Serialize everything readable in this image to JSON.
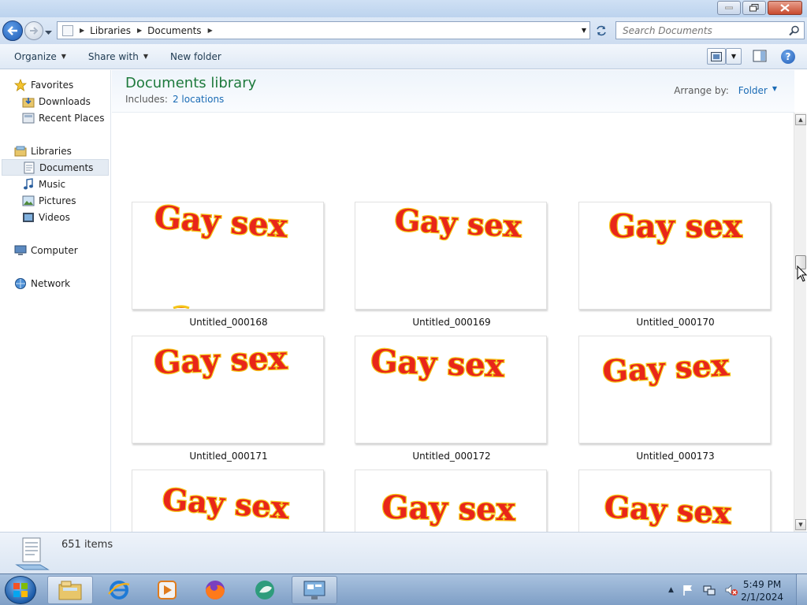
{
  "window": {
    "minimize_icon": "minimize-icon",
    "maximize_icon": "restore-icon",
    "close_icon": "close-icon"
  },
  "address_bar": {
    "crumbs": [
      "Libraries",
      "Documents"
    ],
    "search_placeholder": "Search Documents"
  },
  "toolbar": {
    "organize": "Organize",
    "share_with": "Share with",
    "new_folder": "New folder"
  },
  "nav": {
    "favorites": "Favorites",
    "downloads": "Downloads",
    "recent_places": "Recent Places",
    "libraries": "Libraries",
    "documents": "Documents",
    "music": "Music",
    "pictures": "Pictures",
    "videos": "Videos",
    "computer": "Computer",
    "network": "Network"
  },
  "library": {
    "title": "Documents library",
    "includes_label": "Includes:",
    "includes_link": "2 locations",
    "arrange_label": "Arrange by:",
    "arrange_value": "Folder"
  },
  "files": [
    {
      "name": "Untitled_000168",
      "thumb_text": "Gay sex"
    },
    {
      "name": "Untitled_000169",
      "thumb_text": "Gay sex"
    },
    {
      "name": "Untitled_000170",
      "thumb_text": "Gay sex"
    },
    {
      "name": "Untitled_000171",
      "thumb_text": "Gay sex"
    },
    {
      "name": "Untitled_000172",
      "thumb_text": "Gay sex"
    },
    {
      "name": "Untitled_000173",
      "thumb_text": "Gay sex"
    },
    {
      "name": "",
      "thumb_text": "Gay sex"
    },
    {
      "name": "",
      "thumb_text": "Gay sex"
    },
    {
      "name": "",
      "thumb_text": "Gay sex"
    }
  ],
  "details": {
    "item_count": "651 items"
  },
  "taskbar": {
    "apps": [
      "windows-explorer",
      "internet-explorer",
      "media-player",
      "firefox",
      "app-icon",
      "remote-desktop"
    ]
  },
  "clock": {
    "time": "5:49 PM",
    "date": "2/1/2024"
  },
  "colors": {
    "library_title": "#1e7a3c",
    "link": "#1a6bb5",
    "thumb_text_fill": "#e8261a",
    "thumb_text_outline": "#f5c518"
  }
}
